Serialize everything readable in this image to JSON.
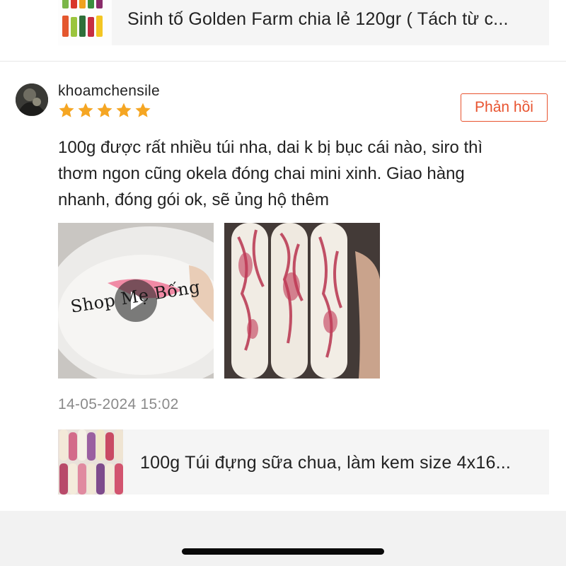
{
  "top_product": {
    "title": "Sinh tố Golden Farm chia lẻ 120gr ( Tách từ c..."
  },
  "review": {
    "username": "khoamchensile",
    "rating": 5,
    "reply_label": "Phản hồi",
    "text_lines": [
      "100g được rất nhiều túi nha, dai k bị bục cái nào, siro thì",
      "thơm ngon cũng okela đóng chai mini xinh. Giao hàng",
      "nhanh, đóng gói ok, sẽ ủng hộ thêm"
    ],
    "media_watermark": "Shop Mẹ Bống",
    "timestamp": "14-05-2024 15:02"
  },
  "bottom_product": {
    "title": "100g Túi đựng sữa chua, làm kem size 4x16..."
  },
  "colors": {
    "accent": "#e8532f",
    "star": "#f5a623",
    "card_bg": "#f5f5f5"
  }
}
